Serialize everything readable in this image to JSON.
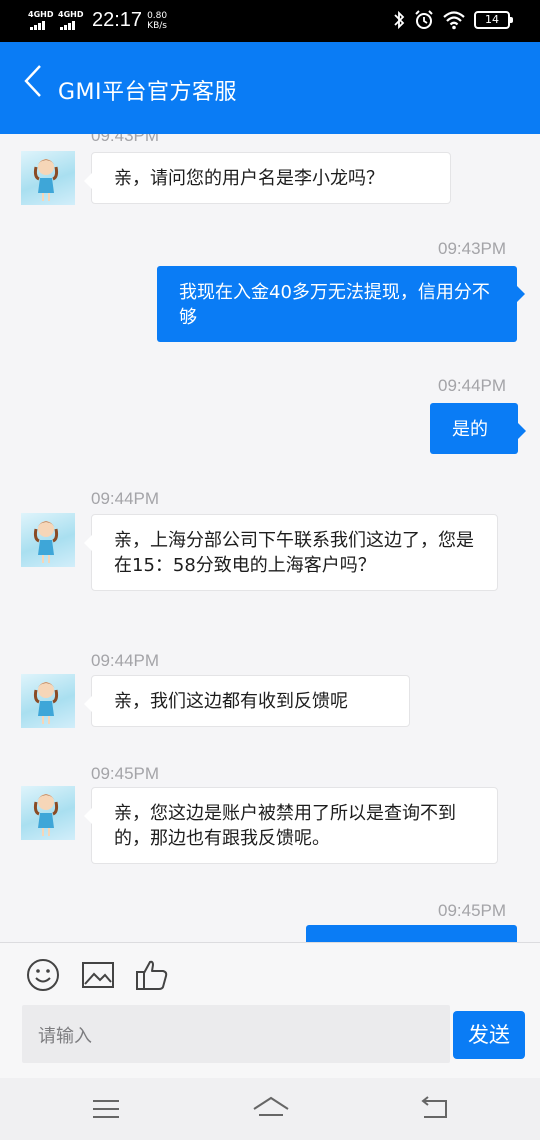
{
  "status_bar": {
    "network1": "4GHD",
    "network2": "4GHD",
    "clock": "22:17",
    "speed_value": "0.80",
    "speed_unit": "KB/s",
    "battery": "14"
  },
  "header": {
    "back_icon": "chevron-left-icon",
    "title": "GMI平台官方客服"
  },
  "messages": [
    {
      "side": "in",
      "time": "09:43PM",
      "text": "亲，请问您的用户名是李小龙吗？"
    },
    {
      "side": "out",
      "time": "09:43PM",
      "text": "我现在入金40多万无法提现，信用分不够"
    },
    {
      "side": "out",
      "time": "09:44PM",
      "text": "是的"
    },
    {
      "side": "in",
      "time": "09:44PM",
      "text": "亲，上海分部公司下午联系我们这边了，您是在15：58分致电的上海客户吗？"
    },
    {
      "side": "in",
      "time": "09:44PM",
      "text": "亲，我们这边都有收到反馈呢"
    },
    {
      "side": "in",
      "time": "09:45PM",
      "text": "亲，您这边是账户被禁用了所以是查询不到的，那边也有跟我反馈呢。"
    },
    {
      "side": "out",
      "time": "09:45PM",
      "text": ""
    }
  ],
  "composer": {
    "emoji_icon": "smiley-icon",
    "image_icon": "image-icon",
    "like_icon": "thumbs-up-icon",
    "placeholder": "请输入",
    "send_label": "发送"
  },
  "nav_bar": {
    "menu_icon": "menu-icon",
    "home_icon": "home-icon",
    "back_icon": "back-icon"
  },
  "colors": {
    "accent": "#0a7cf5",
    "chat_background": "#f5f5f7",
    "timestamp": "#a4a4a8"
  }
}
